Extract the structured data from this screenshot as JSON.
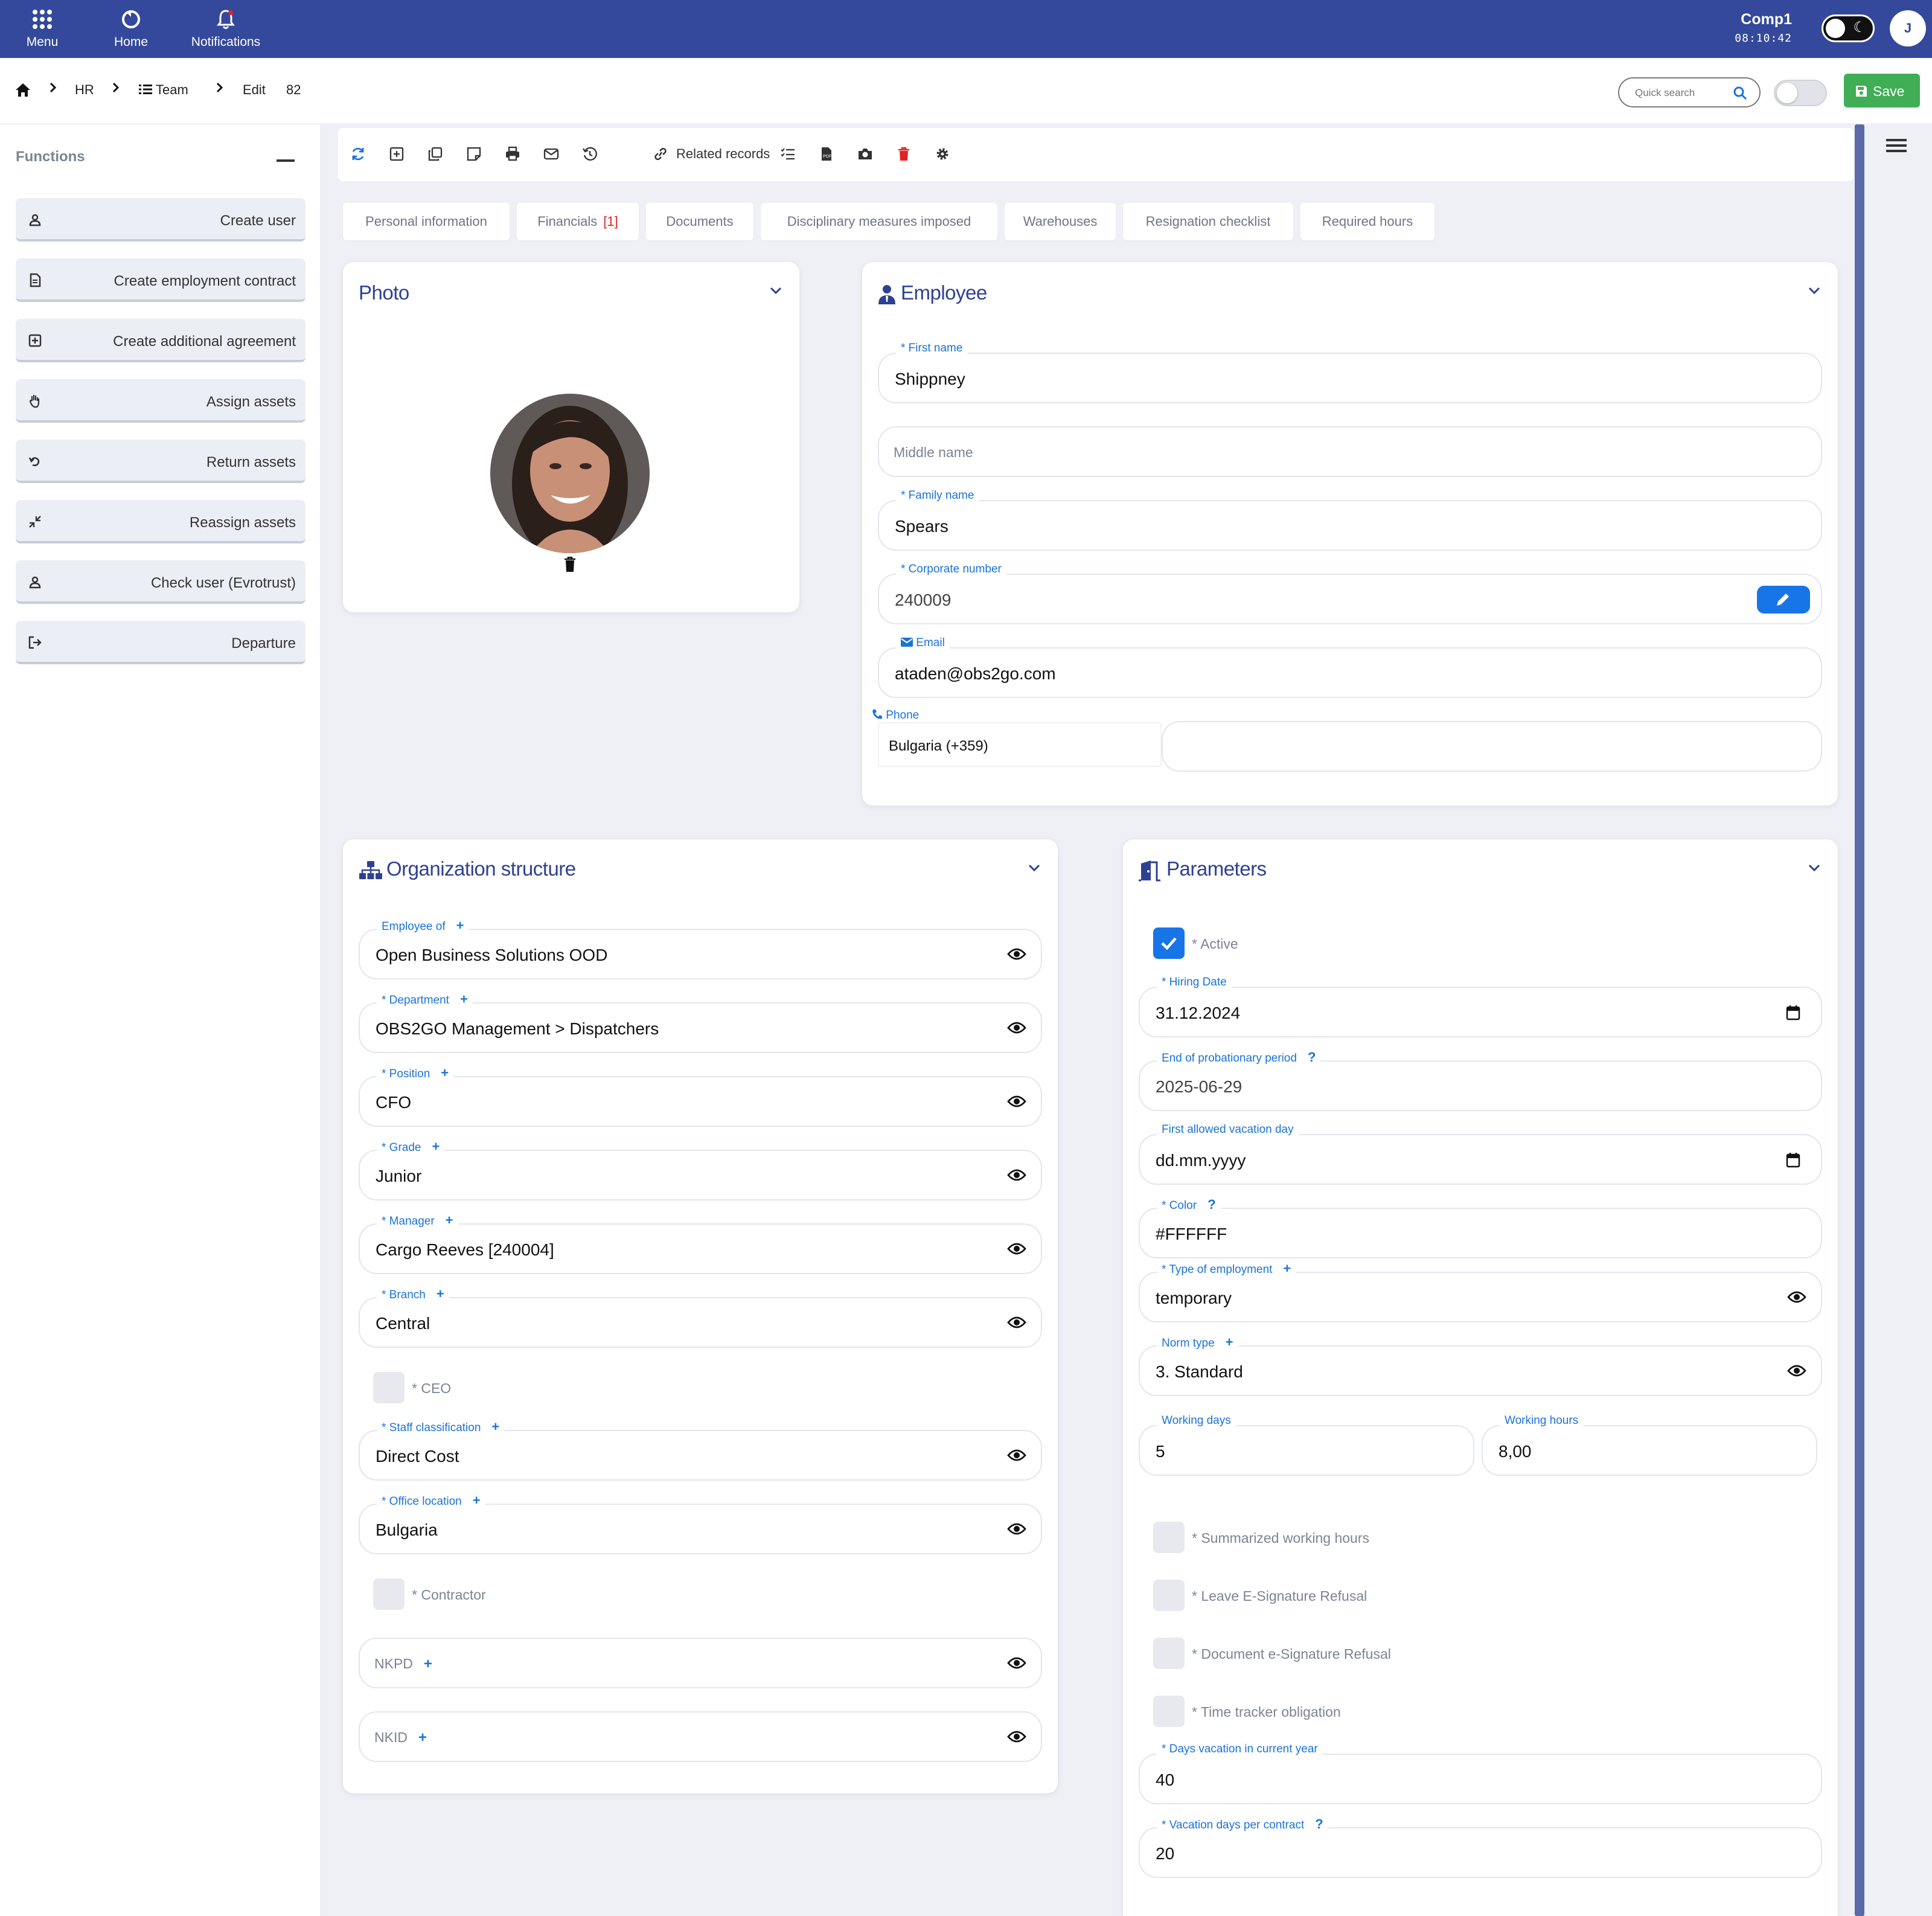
{
  "topbar": {
    "menu_label": "Menu",
    "home_label": "Home",
    "notifications_label": "Notifications",
    "company": "Comp1",
    "time": "08:10:42",
    "user_initial": "J"
  },
  "breadcrumb": {
    "items": [
      "HR",
      "Team",
      "Edit",
      "82"
    ]
  },
  "search": {
    "placeholder": "Quick search"
  },
  "save_label": "Save",
  "functions": {
    "title": "Functions",
    "items": [
      {
        "label": "Create user",
        "icon": "user-icon"
      },
      {
        "label": "Create employment contract",
        "icon": "document-icon"
      },
      {
        "label": "Create additional agreement",
        "icon": "plus-square-icon"
      },
      {
        "label": "Assign assets",
        "icon": "hand-icon"
      },
      {
        "label": "Return assets",
        "icon": "undo-icon"
      },
      {
        "label": "Reassign assets",
        "icon": "compress-icon"
      },
      {
        "label": "Check user (Evrotrust)",
        "icon": "user-icon"
      },
      {
        "label": "Departure",
        "icon": "exit-icon"
      }
    ]
  },
  "toolbar": {
    "related_records": "Related records"
  },
  "tabs": [
    {
      "label": "Personal information"
    },
    {
      "label": "Financials",
      "badge": "[1]"
    },
    {
      "label": "Documents"
    },
    {
      "label": "Disciplinary measures imposed"
    },
    {
      "label": "Warehouses"
    },
    {
      "label": "Resignation checklist"
    },
    {
      "label": "Required hours"
    }
  ],
  "photo": {
    "title": "Photo"
  },
  "employee": {
    "title": "Employee",
    "first_name_label": "* First name",
    "first_name": "Shippney",
    "middle_name_placeholder": "Middle name",
    "family_name_label": "* Family name",
    "family_name": "Spears",
    "corporate_number_label": "* Corporate number",
    "corporate_number": "240009",
    "email_label": "Email",
    "email": "ataden@obs2go.com",
    "phone_label": "Phone",
    "phone_country": "Bulgaria (+359)"
  },
  "org": {
    "title": "Organization structure",
    "employee_of_label": "Employee of",
    "employee_of": "Open Business Solutions OOD",
    "department_label": "* Department",
    "department": "OBS2GO Management > Dispatchers",
    "position_label": "* Position",
    "position": "CFO",
    "grade_label": "* Grade",
    "grade": "Junior",
    "manager_label": "* Manager",
    "manager": "Cargo Reeves [240004]",
    "branch_label": "* Branch",
    "branch": "Central",
    "ceo_label": "* CEO",
    "staff_classification_label": "* Staff classification",
    "staff_classification": "Direct Cost",
    "office_location_label": "* Office location",
    "office_location": "Bulgaria",
    "contractor_label": "* Contractor",
    "nkpd_label": "NKPD",
    "nkid_label": "NKID"
  },
  "params": {
    "title": "Parameters",
    "active_label": "* Active",
    "hiring_date_label": "* Hiring Date",
    "hiring_date": "31.12.2024",
    "probation_label": "End of probationary period",
    "probation": "2025-06-29",
    "vacation_day_label": "First allowed vacation day",
    "vacation_day": "dd.mm.yyyy",
    "color_label": "* Color",
    "color": "#FFFFFF",
    "employment_type_label": "* Type of employment",
    "employment_type": "temporary",
    "norm_type_label": "Norm type",
    "norm_type": "3. Standard",
    "working_days_label": "Working days",
    "working_days": "5",
    "working_hours_label": "Working hours",
    "working_hours": "8,00",
    "summarized_label": "* Summarized working hours",
    "leave_refusal_label": "* Leave E-Signature Refusal",
    "doc_refusal_label": "* Document e-Signature Refusal",
    "tracker_label": "* Time tracker obligation",
    "days_vacation_label": "* Days vacation in current year",
    "days_vacation": "40",
    "vacation_contract_label": "* Vacation days per contract",
    "vacation_contract": "20",
    "help_mark": "?",
    "plus_mark": "+"
  },
  "colors": {
    "brand": "#34499b",
    "accent": "#1775e8",
    "save": "#3fae55",
    "danger": "#e02424"
  }
}
